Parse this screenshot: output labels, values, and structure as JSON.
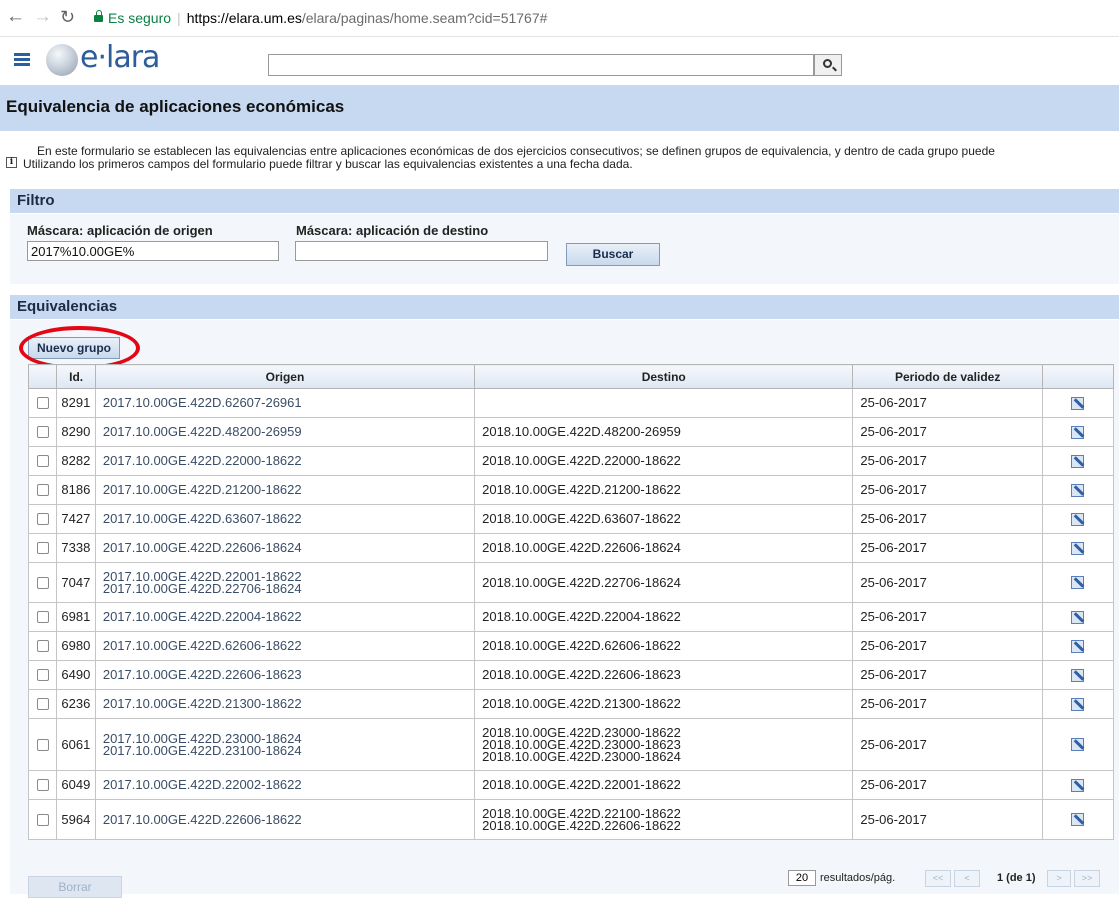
{
  "browser": {
    "secure_label": "Es seguro",
    "url_host": "https://elara.um.es",
    "url_path": "/elara/paginas/home.seam?cid=51767#"
  },
  "app": {
    "logo_text": "e·lara"
  },
  "page": {
    "title": "Equivalencia de aplicaciones económicas",
    "info_line1": "En este formulario se establecen las equivalencias entre aplicaciones económicas de dos ejercicios consecutivos; se definen grupos de equivalencia, y dentro de cada grupo puede",
    "info_line2": "Utilizando los primeros campos del formulario puede filtrar y buscar las equivalencias existentes a una fecha dada."
  },
  "filtro": {
    "title": "Filtro",
    "origen_label": "Máscara: aplicación de origen",
    "origen_value": "2017%10.00GE%",
    "destino_label": "Máscara: aplicación de destino",
    "destino_value": "",
    "buscar_label": "Buscar"
  },
  "equivalencias": {
    "title": "Equivalencias",
    "nuevo_grupo_label": "Nuevo grupo",
    "columns": [
      "Id.",
      "Origen",
      "Destino",
      "Periodo de validez"
    ],
    "rows": [
      {
        "id": "8291",
        "origen": [
          "2017.10.00GE.422D.62607-26961"
        ],
        "destino": [],
        "periodo": "25-06-2017"
      },
      {
        "id": "8290",
        "origen": [
          "2017.10.00GE.422D.48200-26959"
        ],
        "destino": [
          "2018.10.00GE.422D.48200-26959"
        ],
        "periodo": "25-06-2017"
      },
      {
        "id": "8282",
        "origen": [
          "2017.10.00GE.422D.22000-18622"
        ],
        "destino": [
          "2018.10.00GE.422D.22000-18622"
        ],
        "periodo": "25-06-2017"
      },
      {
        "id": "8186",
        "origen": [
          "2017.10.00GE.422D.21200-18622"
        ],
        "destino": [
          "2018.10.00GE.422D.21200-18622"
        ],
        "periodo": "25-06-2017"
      },
      {
        "id": "7427",
        "origen": [
          "2017.10.00GE.422D.63607-18622"
        ],
        "destino": [
          "2018.10.00GE.422D.63607-18622"
        ],
        "periodo": "25-06-2017"
      },
      {
        "id": "7338",
        "origen": [
          "2017.10.00GE.422D.22606-18624"
        ],
        "destino": [
          "2018.10.00GE.422D.22606-18624"
        ],
        "periodo": "25-06-2017"
      },
      {
        "id": "7047",
        "origen": [
          "2017.10.00GE.422D.22001-18622",
          "2017.10.00GE.422D.22706-18624"
        ],
        "destino": [
          "2018.10.00GE.422D.22706-18624"
        ],
        "periodo": "25-06-2017"
      },
      {
        "id": "6981",
        "origen": [
          "2017.10.00GE.422D.22004-18622"
        ],
        "destino": [
          "2018.10.00GE.422D.22004-18622"
        ],
        "periodo": "25-06-2017"
      },
      {
        "id": "6980",
        "origen": [
          "2017.10.00GE.422D.62606-18622"
        ],
        "destino": [
          "2018.10.00GE.422D.62606-18622"
        ],
        "periodo": "25-06-2017"
      },
      {
        "id": "6490",
        "origen": [
          "2017.10.00GE.422D.22606-18623"
        ],
        "destino": [
          "2018.10.00GE.422D.22606-18623"
        ],
        "periodo": "25-06-2017"
      },
      {
        "id": "6236",
        "origen": [
          "2017.10.00GE.422D.21300-18622"
        ],
        "destino": [
          "2018.10.00GE.422D.21300-18622"
        ],
        "periodo": "25-06-2017"
      },
      {
        "id": "6061",
        "origen": [
          "2017.10.00GE.422D.23000-18624",
          "2017.10.00GE.422D.23100-18624"
        ],
        "destino": [
          "2018.10.00GE.422D.23000-18622",
          "2018.10.00GE.422D.23000-18623",
          "2018.10.00GE.422D.23000-18624"
        ],
        "periodo": "25-06-2017"
      },
      {
        "id": "6049",
        "origen": [
          "2017.10.00GE.422D.22002-18622"
        ],
        "destino": [
          "2018.10.00GE.422D.22001-18622"
        ],
        "periodo": "25-06-2017"
      },
      {
        "id": "5964",
        "origen": [
          "2017.10.00GE.422D.22606-18622"
        ],
        "destino": [
          "2018.10.00GE.422D.22100-18622",
          "2018.10.00GE.422D.22606-18622"
        ],
        "periodo": "25-06-2017"
      }
    ],
    "borrar_label": "Borrar",
    "page_size": "20",
    "page_size_label": "resultados/pág.",
    "page_first": "<<",
    "page_prev": "<",
    "page_current": "1 (de 1)",
    "page_next": ">",
    "page_last": ">>"
  }
}
